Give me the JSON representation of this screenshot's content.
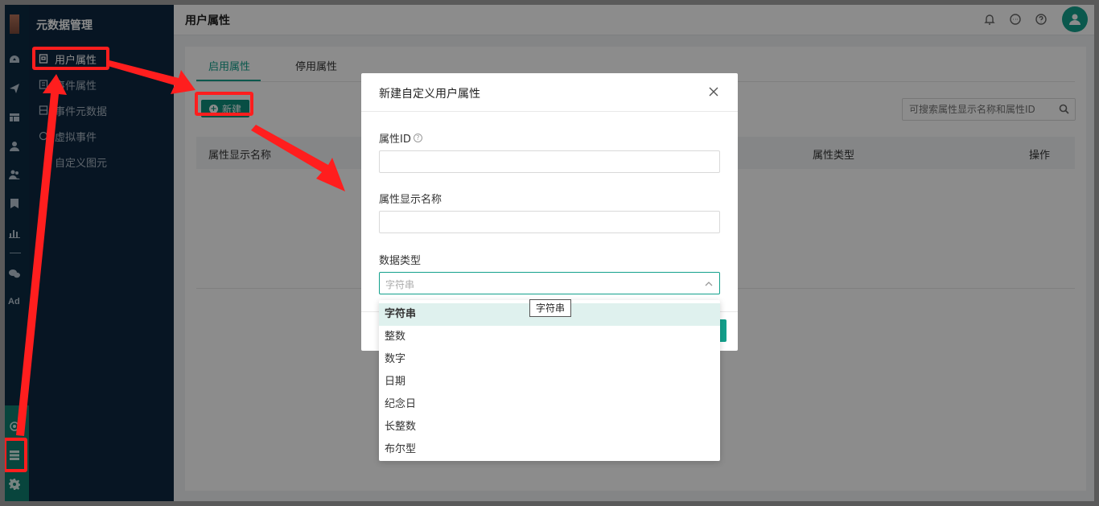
{
  "subnav": {
    "title": "元数据管理",
    "items": [
      "用户属性",
      "事件属性",
      "事件元数据",
      "虚拟事件",
      "自定义图元"
    ]
  },
  "header": {
    "title": "用户属性"
  },
  "tabs": [
    "启用属性",
    "停用属性"
  ],
  "new_button": "新建",
  "search": {
    "placeholder": "可搜索属性显示名称和属性ID"
  },
  "table": {
    "columns": [
      "属性显示名称",
      "属性类型",
      "操作"
    ]
  },
  "modal": {
    "title": "新建自定义用户属性",
    "fields": [
      {
        "label": "属性ID",
        "value": ""
      },
      {
        "label": "属性显示名称",
        "value": ""
      }
    ],
    "type_label": "数据类型",
    "type_value": "字符串",
    "options": [
      "字符串",
      "整数",
      "数字",
      "日期",
      "纪念日",
      "长整数",
      "布尔型"
    ],
    "tooltip": "字符串"
  },
  "rail": {
    "ad_label": "Ad"
  },
  "colors": {
    "accent": "#13a08c",
    "nav_bg": "#0d2740",
    "annotation": "#ff1e1e"
  }
}
